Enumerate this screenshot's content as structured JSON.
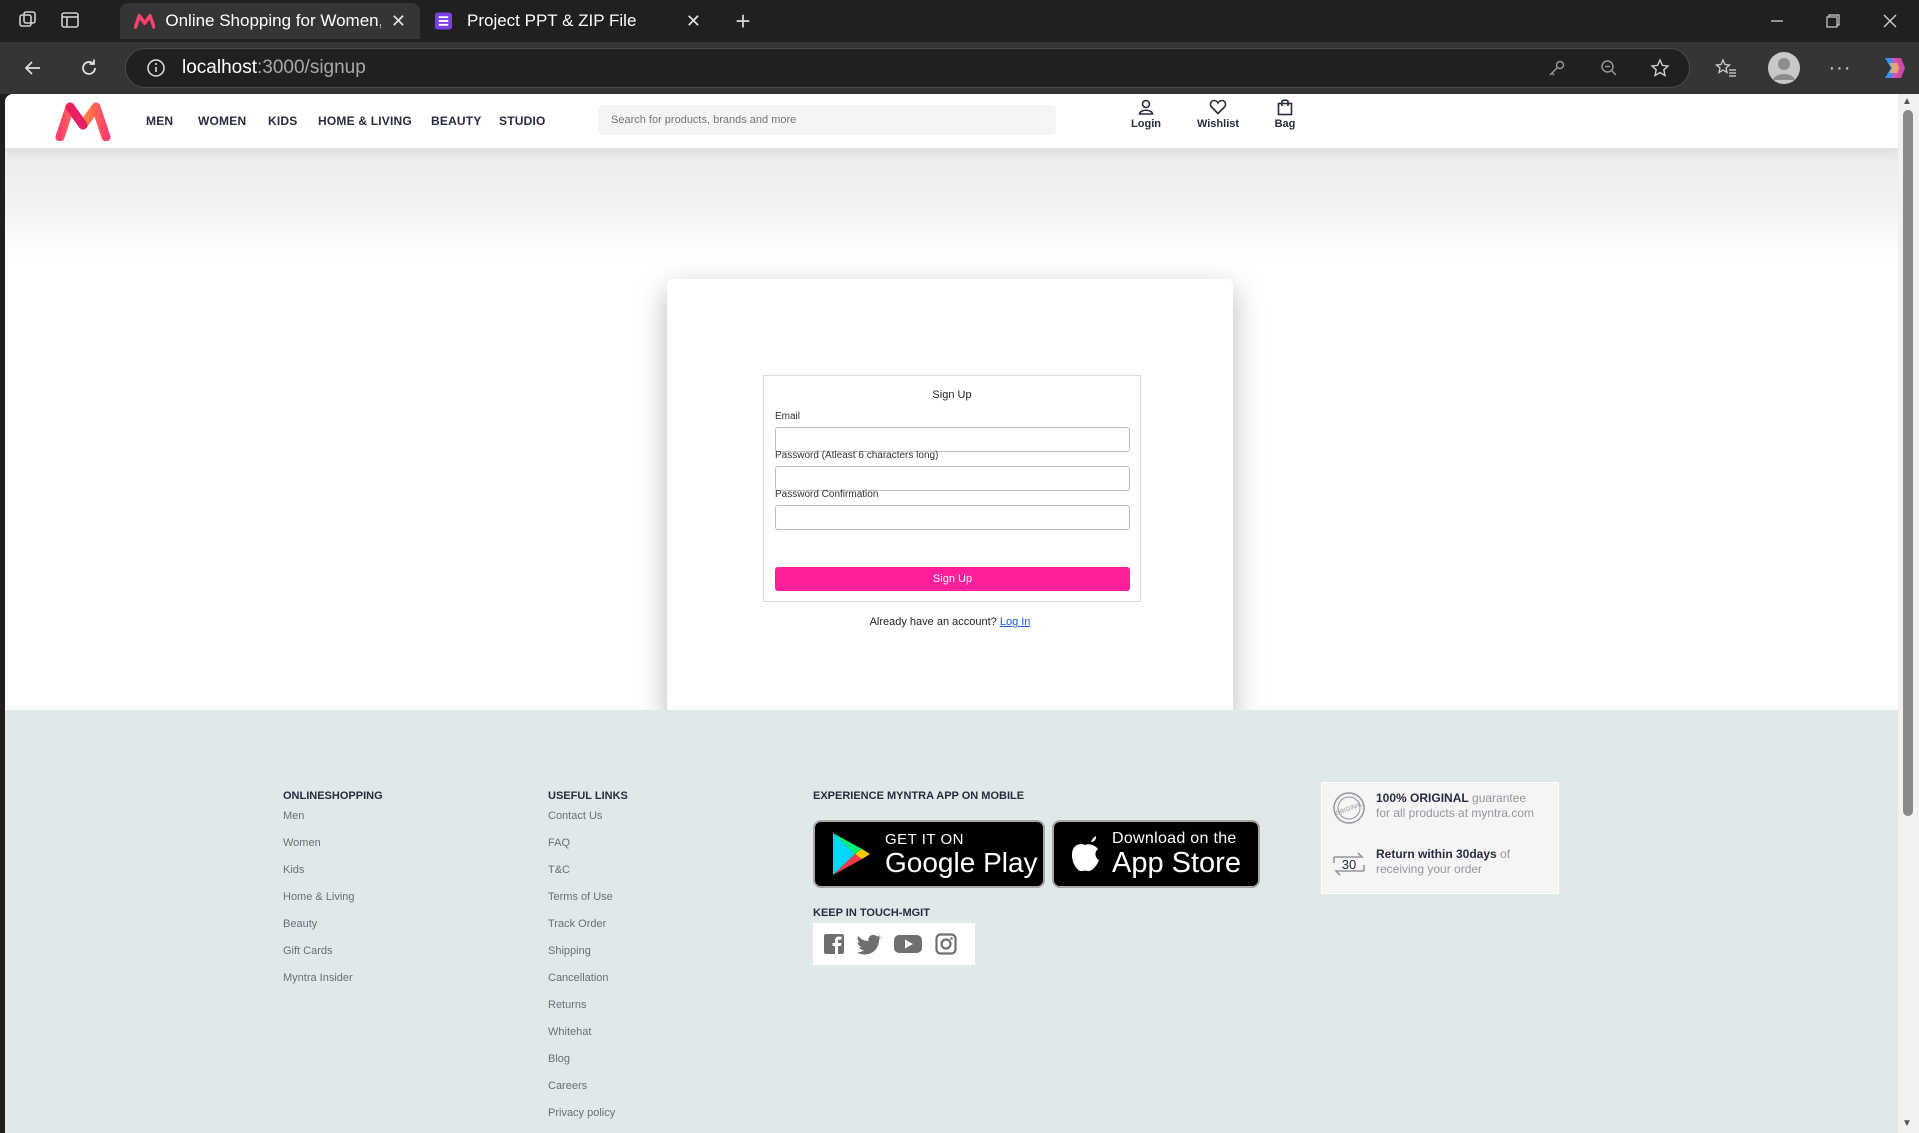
{
  "browser": {
    "tabs": [
      {
        "title": "Online Shopping for Women, Men",
        "active": true
      },
      {
        "title": "Project PPT & ZIP File",
        "active": false
      }
    ],
    "url_host": "localhost",
    "url_path": ":3000/signup"
  },
  "header": {
    "nav": [
      "MEN",
      "WOMEN",
      "KIDS",
      "HOME & LIVING",
      "BEAUTY",
      "STUDIO"
    ],
    "search_placeholder": "Search for products, brands and more",
    "actions": {
      "login": "Login",
      "wishlist": "Wishlist",
      "bag": "Bag"
    }
  },
  "signup": {
    "title": "Sign Up",
    "email_label": "Email",
    "password_label": "Password (Atleast 6 characters long)",
    "confirm_label": "Password Confirmation",
    "submit_label": "Sign Up",
    "already_text": "Already have an account?",
    "login_link": "Log In"
  },
  "footer": {
    "online_title": "ONLINESHOPPING",
    "online_links": [
      "Men",
      "Women",
      "Kids",
      "Home & Living",
      "Beauty",
      "Gift Cards",
      "Myntra Insider"
    ],
    "useful_title": "USEFUL LINKS",
    "useful_links": [
      "Contact Us",
      "FAQ",
      "T&C",
      "Terms of Use",
      "Track Order",
      "Shipping",
      "Cancellation",
      "Returns",
      "Whitehat",
      "Blog",
      "Careers",
      "Privacy policy"
    ],
    "app_title": "EXPERIENCE MYNTRA APP ON MOBILE",
    "google_small": "GET IT ON",
    "google_big": "Google Play",
    "apple_small": "Download on the",
    "apple_big": "App Store",
    "social_title": "KEEP IN TOUCH-MGIT",
    "original_bold": "100% ORIGINAL",
    "original_rest": " guarantee",
    "original_line2": "for all products at myntra.com",
    "return_bold": "Return within 30days",
    "return_rest": " of",
    "return_line2": "receiving your order",
    "original_seal": "ORIGINAL",
    "return_number": "30"
  },
  "colors": {
    "accent": "#ff1f9b",
    "footer_bg": "#e0e9e9"
  }
}
